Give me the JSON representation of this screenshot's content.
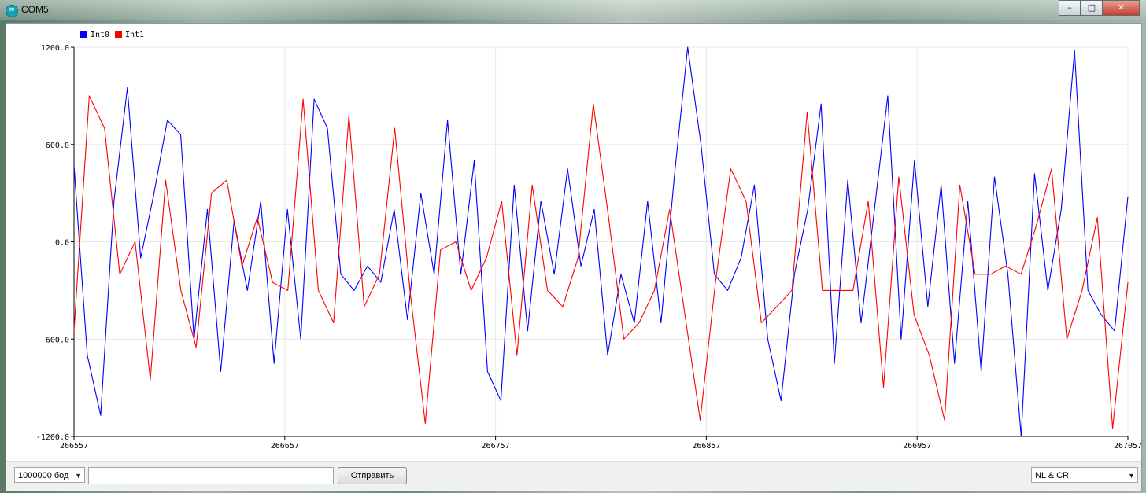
{
  "window": {
    "title": "COM5"
  },
  "footer": {
    "baud": "1000000 бод",
    "input_value": "",
    "send_label": "Отправить",
    "line_ending": "NL & CR"
  },
  "chart_data": {
    "type": "line",
    "legend": [
      {
        "name": "Int0",
        "color": "#0000ff"
      },
      {
        "name": "Int1",
        "color": "#ff0000"
      }
    ],
    "legend_position": "top-left",
    "grid": true,
    "ylim": [
      -1200,
      1200
    ],
    "xlim": [
      266557,
      267057
    ],
    "y_ticks": [
      "1200.0",
      "600.0",
      "0.0",
      "-600.0",
      "-1200.0"
    ],
    "x_ticks": [
      "266557",
      "266657",
      "266757",
      "266857",
      "266957",
      "267057"
    ],
    "x": [
      266557,
      266562,
      266567,
      266572,
      266577,
      266582,
      266587,
      266592,
      266597,
      266602,
      266607,
      266612,
      266617,
      266622,
      266627,
      266632,
      266637,
      266642,
      266647,
      266652,
      266657,
      266662,
      266667,
      266672,
      266677,
      266682,
      266687,
      266692,
      266697,
      266702,
      266707,
      266712,
      266717,
      266722,
      266727,
      266732,
      266737,
      266742,
      266747,
      266752,
      266757,
      266762,
      266767,
      266772,
      266777,
      266782,
      266787,
      266792,
      266797,
      266802,
      266807,
      266812,
      266817,
      266822,
      266827,
      266832,
      266837,
      266842,
      266847,
      266852,
      266857,
      266862,
      266867,
      266872,
      266877,
      266882,
      266887,
      266892,
      266897,
      266902,
      266907,
      266912,
      266917,
      266922,
      266927,
      266932,
      266937,
      266942,
      266947,
      266952,
      266957,
      266962,
      266967,
      266972,
      266977,
      266982,
      266987,
      266992,
      266997,
      267002,
      267007,
      267012,
      267017,
      267022,
      267027,
      267032,
      267037,
      267042,
      267047,
      267052,
      267057
    ],
    "series": [
      {
        "name": "Int0",
        "color": "#0000ff",
        "values": [
          470,
          -700,
          -1070,
          250,
          950,
          -100,
          300,
          750,
          660,
          -600,
          200,
          -800,
          130,
          -300,
          250,
          -750,
          200,
          -600,
          880,
          700,
          -200,
          -300,
          -150,
          -250,
          200,
          -480,
          300,
          -200,
          750,
          -200,
          500,
          -800,
          -980,
          350,
          -550,
          250,
          -200,
          450,
          -150,
          200,
          -700,
          -200,
          -500,
          250,
          -500,
          400,
          1200,
          600,
          -200,
          -300,
          -100,
          350,
          -600,
          -980,
          -200,
          200,
          850,
          -750,
          380,
          -500,
          200,
          900,
          -600,
          500,
          -400,
          350,
          -750,
          250,
          -800,
          400,
          -200,
          -1200,
          420,
          -300,
          200,
          1180,
          -300,
          -450,
          -550,
          280
        ]
      },
      {
        "name": "Int1",
        "color": "#ff0000",
        "values": [
          -550,
          900,
          700,
          -200,
          0,
          -850,
          380,
          -300,
          -650,
          300,
          380,
          -150,
          150,
          -250,
          -300,
          880,
          -300,
          -500,
          780,
          -400,
          -200,
          700,
          -300,
          -1120,
          -50,
          0,
          -300,
          -100,
          250,
          -700,
          350,
          -300,
          -400,
          -100,
          850,
          150,
          -600,
          -500,
          -300,
          200,
          -450,
          -1100,
          -250,
          450,
          250,
          -500,
          -400,
          -300,
          800,
          -300,
          -300,
          -300,
          250,
          -900,
          400,
          -450,
          -700,
          -1100,
          350,
          -200,
          -200,
          -150,
          -200,
          100,
          450,
          -600,
          -300,
          150,
          -1150,
          -250
        ]
      }
    ]
  }
}
